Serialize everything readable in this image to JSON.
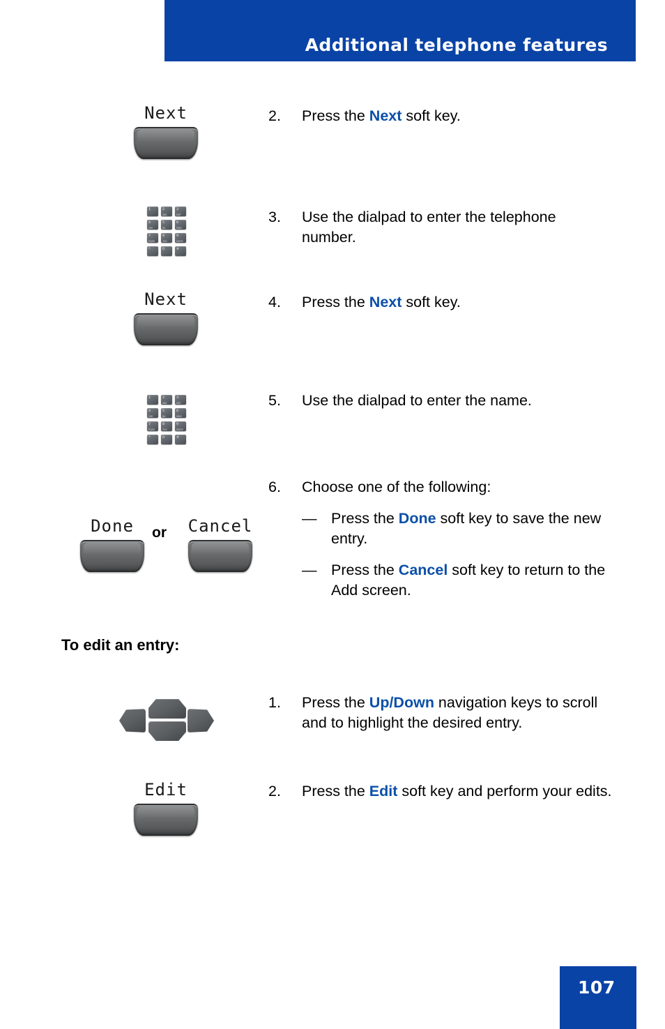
{
  "header": {
    "title": "Additional telephone features",
    "band_color": "#0A43A6"
  },
  "colors": {
    "accent_blue": "#0A43A6",
    "keyword_blue": "#0B4FA8",
    "key_gray": "#5c5f62"
  },
  "steps": [
    {
      "number": "2.",
      "text_before": "Press the ",
      "keyword": "Next",
      "text_after": " soft key.",
      "icon": "softkey-next",
      "softkey_label": "Next"
    },
    {
      "number": "3.",
      "text_before": "Use the dialpad to enter the telephone number.",
      "keyword": "",
      "text_after": "",
      "icon": "dialpad"
    },
    {
      "number": "4.",
      "text_before": "Press the ",
      "keyword": "Next",
      "text_after": " soft key.",
      "icon": "softkey-next",
      "softkey_label": "Next"
    },
    {
      "number": "5.",
      "text_before": "Use the dialpad to enter the name.",
      "keyword": "",
      "text_after": "",
      "icon": "dialpad"
    },
    {
      "number": "6.",
      "text_before": "Choose one of the following:",
      "keyword": "",
      "text_after": "",
      "icon": "softkey-done-or-cancel",
      "subitems": [
        {
          "dash": "—",
          "text_before": "Press the ",
          "keyword": "Done",
          "text_after": " soft key to save the new entry."
        },
        {
          "dash": "—",
          "text_before": "Press the ",
          "keyword": "Cancel",
          "text_after": " soft key to return to the Add screen."
        }
      ]
    }
  ],
  "choice_keys": {
    "done_label": "Done",
    "or_label": "or",
    "cancel_label": "Cancel"
  },
  "section": {
    "heading": "To edit an entry:",
    "steps": [
      {
        "number": "1.",
        "text_before": "Press the ",
        "keyword": "Up/Down",
        "text_after": " navigation keys to scroll and to highlight the desired entry.",
        "icon": "navigation-cluster"
      },
      {
        "number": "2.",
        "text_before": "Press the ",
        "keyword": "Edit",
        "text_after": " soft key and perform your edits.",
        "icon": "softkey-edit",
        "softkey_label": "Edit"
      }
    ]
  },
  "dialpad": {
    "keys": [
      {
        "main": "1",
        "sub": ""
      },
      {
        "main": "2",
        "sub": "ABC"
      },
      {
        "main": "3",
        "sub": "DEF"
      },
      {
        "main": "4",
        "sub": "GHI"
      },
      {
        "main": "5",
        "sub": "JKL"
      },
      {
        "main": "6",
        "sub": "MNO"
      },
      {
        "main": "7",
        "sub": "PQRS"
      },
      {
        "main": "8",
        "sub": "TUV"
      },
      {
        "main": "9",
        "sub": "WXYZ"
      },
      {
        "main": "*",
        "sub": ""
      },
      {
        "main": "0",
        "sub": ""
      },
      {
        "main": "#",
        "sub": ""
      }
    ]
  },
  "footer": {
    "page_number": "107"
  }
}
